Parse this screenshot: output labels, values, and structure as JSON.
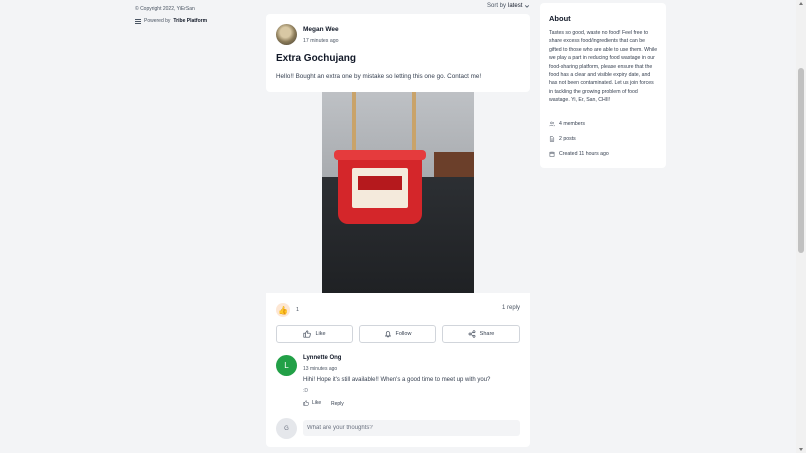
{
  "footer": {
    "copyright": "© Copyright 2022, YiErSan",
    "powered_prefix": "Powered by",
    "powered_brand": "Tribe Platform"
  },
  "sort": {
    "label": "Sort by",
    "value": "latest"
  },
  "post": {
    "author": "Megan Wee",
    "time": "17 minutes ago",
    "title": "Extra Gochujang",
    "body": "Hello!! Bought an extra one by mistake so letting this one go. Contact me!",
    "reaction_count": "1",
    "reply_count": "1 reply"
  },
  "actions": {
    "like": "Like",
    "follow": "Follow",
    "share": "Share"
  },
  "comment": {
    "avatar_letter": "L",
    "author": "Lynnette Ong",
    "time": "13 minutes ago",
    "text": "Hihi! Hope it's still available!! When's a good time to meet up with you?",
    "emoji": ":D",
    "like": "Like",
    "reply": "Reply"
  },
  "composer": {
    "avatar_letter": "G",
    "placeholder": "What are your thoughts?"
  },
  "about": {
    "title": "About",
    "description": "Tastes so good, waste no food! Feel free to share excess food/ingredients that can be gifted to those who are able to use them. While we play a part in reducing food wastage in our food-sharing platform, please ensure that the food has a clear and visible expiry date, and has not been contaminated. Let us join forces in tackling the growing problem of food wastage. Yi, Er, San, CHII!",
    "members": "4 members",
    "posts": "2 posts",
    "created": "Created 11 hours ago"
  },
  "colors": {
    "page_bg": "#f3f4f6",
    "card_bg": "#ffffff",
    "comment_avatar": "#22a047",
    "tub_red": "#d4262a"
  },
  "icons": {
    "powered": "tribe-logo-icon",
    "sort": "chevron-down-icon",
    "like": "thumbs-up-icon",
    "follow": "bell-icon",
    "share": "share-icon",
    "members": "members-icon",
    "posts": "document-icon",
    "created": "calendar-icon"
  }
}
